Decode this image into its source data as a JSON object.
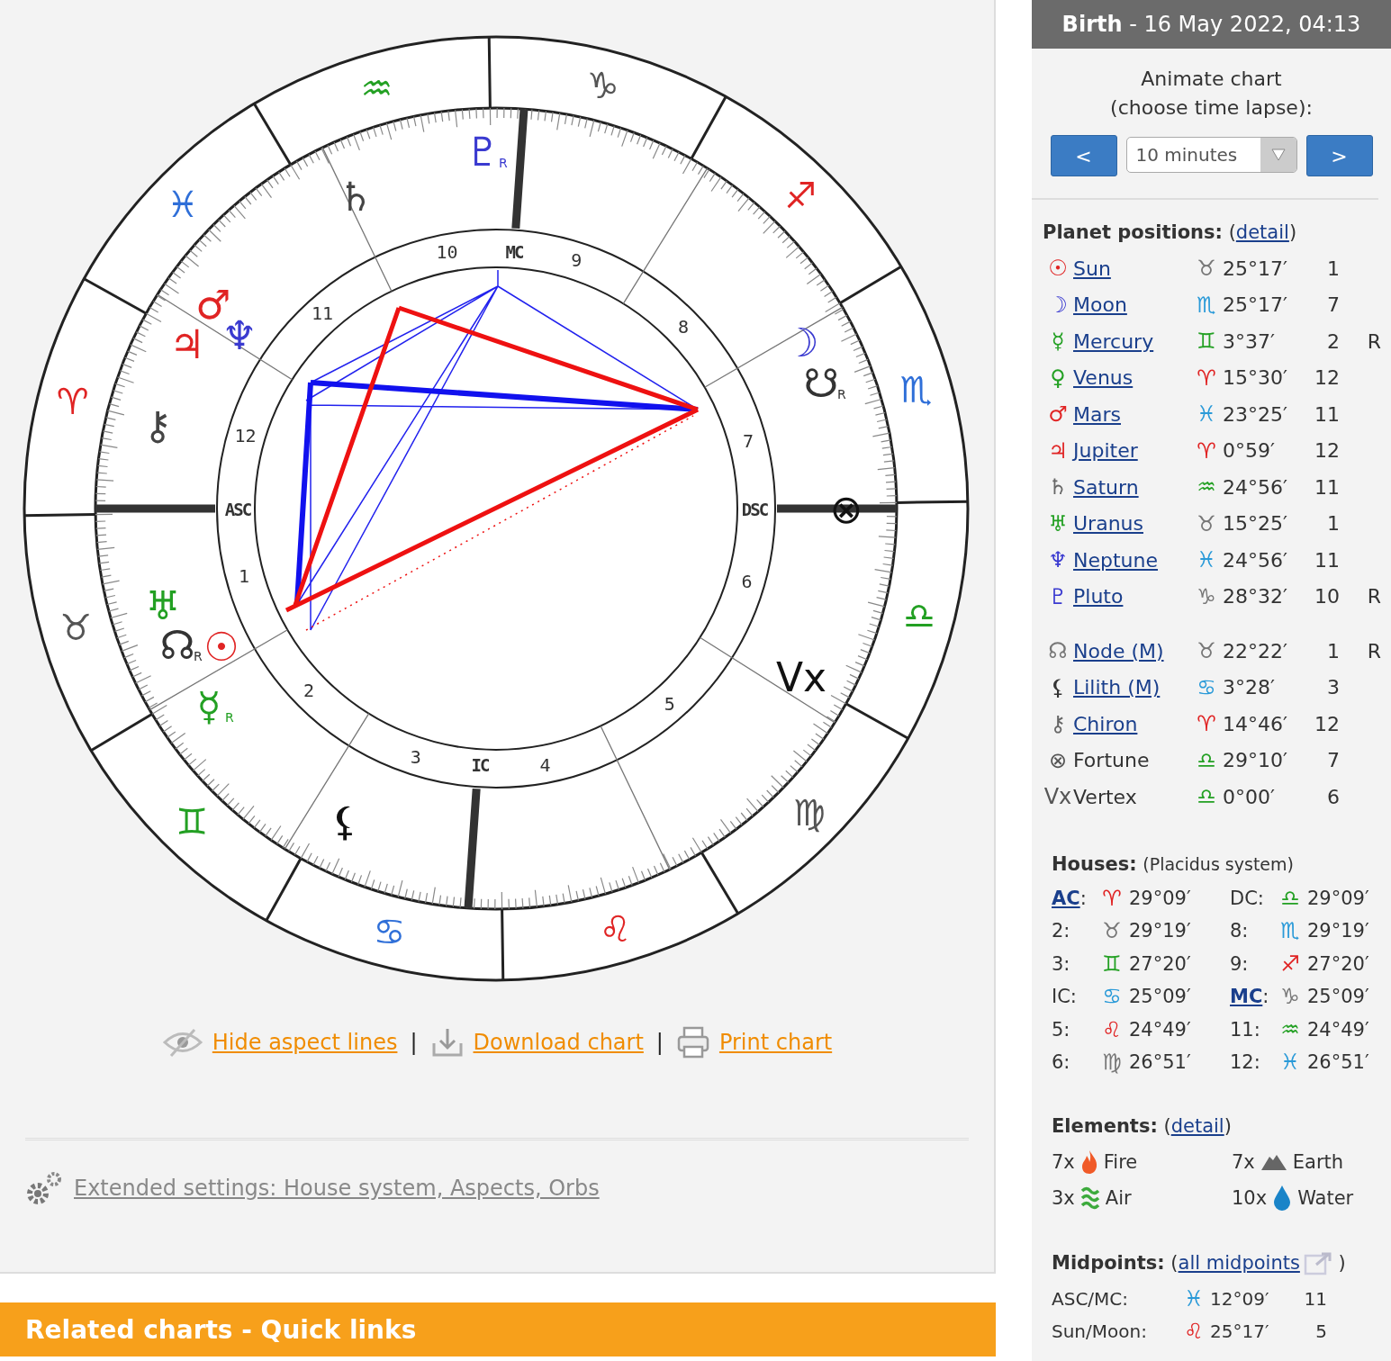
{
  "wheel": {
    "signs": [
      {
        "glyph": "♈",
        "color": "#e02424"
      },
      {
        "glyph": "♉",
        "color": "#555555"
      },
      {
        "glyph": "♊",
        "color": "#23a023"
      },
      {
        "glyph": "♋",
        "color": "#2f6fd8"
      },
      {
        "glyph": "♌",
        "color": "#e02424"
      },
      {
        "glyph": "♍",
        "color": "#555555"
      },
      {
        "glyph": "♎",
        "color": "#23a023"
      },
      {
        "glyph": "♏",
        "color": "#2f6fd8"
      },
      {
        "glyph": "♐",
        "color": "#e02424"
      },
      {
        "glyph": "♑",
        "color": "#555555"
      },
      {
        "glyph": "♒",
        "color": "#23a023"
      },
      {
        "glyph": "♓",
        "color": "#2f6fd8"
      }
    ],
    "house_numbers": [
      "1",
      "2",
      "3",
      "4",
      "5",
      "6",
      "7",
      "8",
      "9",
      "10",
      "11",
      "12"
    ],
    "angles": [
      "ASC",
      "IC",
      "DSC",
      "MC"
    ],
    "planets": [
      {
        "glyph": "♇",
        "color": "#3a3ad0",
        "retrograde": "R"
      },
      {
        "glyph": "♄",
        "color": "#444444"
      },
      {
        "glyph": "♂",
        "color": "#e02424"
      },
      {
        "glyph": "♃",
        "color": "#e02424"
      },
      {
        "glyph": "♆",
        "color": "#3a3ad0"
      },
      {
        "glyph": "⚷",
        "color": "#444444"
      },
      {
        "glyph": "☽",
        "color": "#3a3ad0"
      },
      {
        "glyph": "☋",
        "color": "#333333",
        "retrograde": "R"
      },
      {
        "glyph": "⊗",
        "color": "#111111"
      },
      {
        "glyph": "♅",
        "color": "#23a023"
      },
      {
        "glyph": "☊",
        "color": "#333333",
        "retrograde": "R"
      },
      {
        "glyph": "☉",
        "color": "#e02424"
      },
      {
        "glyph": "☿",
        "color": "#23a023",
        "retrograde": "R"
      },
      {
        "glyph": "Vx",
        "color": "#111111"
      },
      {
        "glyph": "⚸",
        "color": "#111111"
      }
    ]
  },
  "actions": [
    {
      "kind": "eye",
      "label": "Hide aspect lines",
      "separator": "|"
    },
    {
      "kind": "download",
      "label": "Download chart",
      "separator": "|"
    },
    {
      "kind": "print",
      "label": "Print chart"
    }
  ],
  "extended_settings": "Extended settings: House system, Aspects, Orbs",
  "related_bar": "Related charts - Quick links",
  "side": {
    "title": "**Birth** - 16 May 2022, 04:13",
    "animate_label": [
      "Animate chart",
      "(choose time lapse):"
    ],
    "prev_button": "<",
    "next_button": ">",
    "time_lapse": "10 minutes",
    "planets_heading": {
      "title": "Planet positions:",
      "open": "(",
      "link": "detail",
      "close": ")"
    },
    "planets": [
      {
        "glyph": "☉",
        "color": "#e02424",
        "name": "Sun",
        "link": true,
        "sign": {
          "glyph": "♉",
          "color": "#777777"
        },
        "position": "25°17′",
        "house": "1"
      },
      {
        "glyph": "☽",
        "color": "#3a3ad0",
        "name": "Moon",
        "link": true,
        "sign": {
          "glyph": "♏",
          "color": "#2a9ad8"
        },
        "position": "25°17′",
        "house": "7"
      },
      {
        "glyph": "☿",
        "color": "#23a023",
        "name": "Mercury",
        "link": true,
        "sign": {
          "glyph": "♊",
          "color": "#23a023"
        },
        "position": "3°37′",
        "house": "2",
        "retrograde": "R"
      },
      {
        "glyph": "♀",
        "color": "#23a023",
        "name": "Venus",
        "link": true,
        "sign": {
          "glyph": "♈",
          "color": "#e02424"
        },
        "position": "15°30′",
        "house": "12"
      },
      {
        "glyph": "♂",
        "color": "#e02424",
        "name": "Mars",
        "link": true,
        "sign": {
          "glyph": "♓",
          "color": "#2a9ad8"
        },
        "position": "23°25′",
        "house": "11"
      },
      {
        "glyph": "♃",
        "color": "#e02424",
        "name": "Jupiter",
        "link": true,
        "sign": {
          "glyph": "♈",
          "color": "#e02424"
        },
        "position": "0°59′",
        "house": "12"
      },
      {
        "glyph": "♄",
        "color": "#666666",
        "name": "Saturn",
        "link": true,
        "sign": {
          "glyph": "♒",
          "color": "#23a023"
        },
        "position": "24°56′",
        "house": "11"
      },
      {
        "glyph": "♅",
        "color": "#23a023",
        "name": "Uranus",
        "link": true,
        "sign": {
          "glyph": "♉",
          "color": "#777777"
        },
        "position": "15°25′",
        "house": "1"
      },
      {
        "glyph": "♆",
        "color": "#3a3ad0",
        "name": "Neptune",
        "link": true,
        "sign": {
          "glyph": "♓",
          "color": "#2a9ad8"
        },
        "position": "24°56′",
        "house": "11"
      },
      {
        "glyph": "♇",
        "color": "#3a3ad0",
        "name": "Pluto",
        "link": true,
        "sign": {
          "glyph": "♑",
          "color": "#777777"
        },
        "position": "28°32′",
        "house": "10",
        "retrograde": "R"
      }
    ],
    "points": [
      {
        "glyph": "☊",
        "color": "#777777",
        "name": "Node (M)",
        "link": true,
        "sign": {
          "glyph": "♉",
          "color": "#777777"
        },
        "position": "22°22′",
        "house": "1",
        "retrograde": "R"
      },
      {
        "glyph": "⚸",
        "color": "#333333",
        "name": "Lilith (M)",
        "link": true,
        "sign": {
          "glyph": "♋",
          "color": "#2a9ad8"
        },
        "position": "3°28′",
        "house": "3"
      },
      {
        "glyph": "⚷",
        "color": "#666666",
        "name": "Chiron",
        "link": true,
        "sign": {
          "glyph": "♈",
          "color": "#e02424"
        },
        "position": "14°46′",
        "house": "12"
      },
      {
        "glyph": "⊗",
        "color": "#555555",
        "name": "Fortune",
        "link": false,
        "sign": {
          "glyph": "♎",
          "color": "#23a023"
        },
        "position": "29°10′",
        "house": "7"
      },
      {
        "glyph": "Vx",
        "color": "#555555",
        "name": "Vertex",
        "link": false,
        "sign": {
          "glyph": "♎",
          "color": "#23a023"
        },
        "position": "0°00′",
        "house": "6"
      }
    ],
    "houses_heading": {
      "title": "Houses:",
      "note": "(Placidus system)"
    },
    "houses": [
      {
        "label": "AC",
        "link": true,
        "after": ":",
        "sign": {
          "glyph": "♈",
          "color": "#e02424"
        },
        "position": "29°09′"
      },
      {
        "label": "DC:",
        "link": false,
        "sign": {
          "glyph": "♎",
          "color": "#23a023"
        },
        "position": "29°09′"
      },
      {
        "label": "2:",
        "link": false,
        "sign": {
          "glyph": "♉",
          "color": "#777777"
        },
        "position": "29°19′"
      },
      {
        "label": "8:",
        "link": false,
        "sign": {
          "glyph": "♏",
          "color": "#2a9ad8"
        },
        "position": "29°19′"
      },
      {
        "label": "3:",
        "link": false,
        "sign": {
          "glyph": "♊",
          "color": "#23a023"
        },
        "position": "27°20′"
      },
      {
        "label": "9:",
        "link": false,
        "sign": {
          "glyph": "♐",
          "color": "#e02424"
        },
        "position": "27°20′"
      },
      {
        "label": "IC:",
        "link": false,
        "sign": {
          "glyph": "♋",
          "color": "#2a9ad8"
        },
        "position": "25°09′"
      },
      {
        "label": "MC",
        "link": true,
        "after": ":",
        "sign": {
          "glyph": "♑",
          "color": "#777777"
        },
        "position": "25°09′"
      },
      {
        "label": "5:",
        "link": false,
        "sign": {
          "glyph": "♌",
          "color": "#e02424"
        },
        "position": "24°49′"
      },
      {
        "label": "11:",
        "link": false,
        "sign": {
          "glyph": "♒",
          "color": "#23a023"
        },
        "position": "24°49′"
      },
      {
        "label": "6:",
        "link": false,
        "sign": {
          "glyph": "♍",
          "color": "#777777"
        },
        "position": "26°51′"
      },
      {
        "label": "12:",
        "link": false,
        "sign": {
          "glyph": "♓",
          "color": "#2a9ad8"
        },
        "position": "26°51′"
      }
    ],
    "elements_heading": {
      "title": "Elements:",
      "open": "(",
      "link": "detail",
      "close": ")"
    },
    "elements": [
      {
        "kind": "fire",
        "count": "7x",
        "name": "Fire"
      },
      {
        "kind": "earth",
        "count": "7x",
        "name": "Earth"
      },
      {
        "kind": "air",
        "count": "3x",
        "name": "Air"
      },
      {
        "kind": "water",
        "count": "10x",
        "name": "Water"
      }
    ],
    "midpoints_heading": {
      "title": "Midpoints:",
      "open": "(",
      "link": "all midpoints",
      "close": ")"
    },
    "midpoints": [
      {
        "label": "ASC/MC:",
        "sign": {
          "glyph": "♓",
          "color": "#2a9ad8"
        },
        "position": "12°09′",
        "house": "11"
      },
      {
        "label": "Sun/Moon:",
        "sign": {
          "glyph": "♌",
          "color": "#e02424"
        },
        "position": "25°17′",
        "house": "5"
      }
    ]
  }
}
